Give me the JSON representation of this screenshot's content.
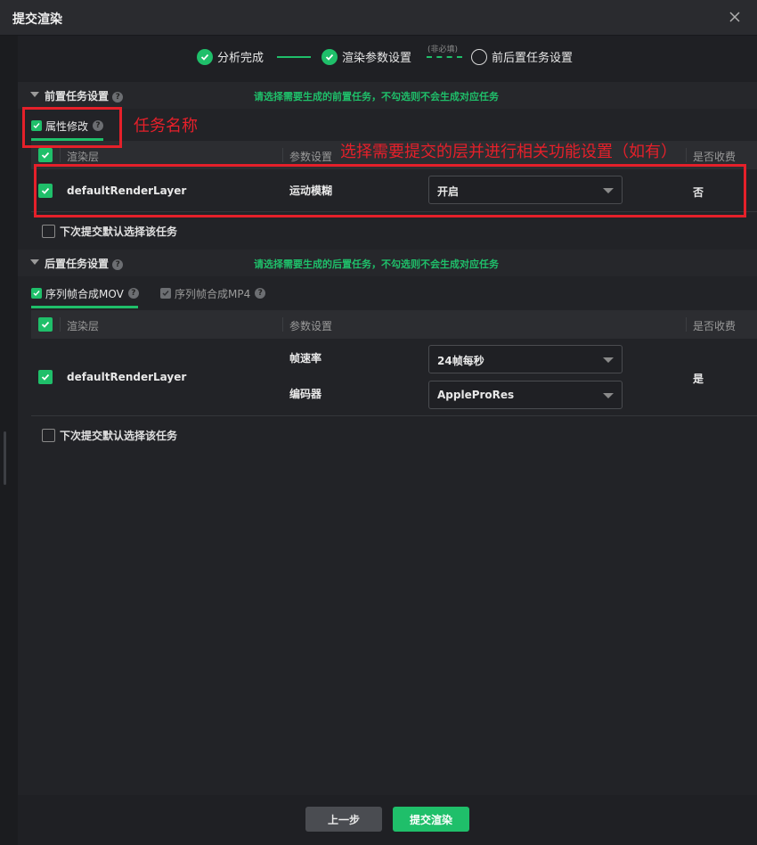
{
  "dialog": {
    "title": "提交渲染"
  },
  "steps": {
    "step1": "分析完成",
    "step2": "渲染参数设置",
    "optional": "(非必填)",
    "step3": "前后置任务设置"
  },
  "pre_task": {
    "section_label": "前置任务设置",
    "hint": "请选择需要生成的前置任务，不勾选则不会生成对应任务",
    "tab_label": "属性修改",
    "columns": {
      "layer": "渲染层",
      "params": "参数设置",
      "charge": "是否收费"
    },
    "row": {
      "layer": "defaultRenderLayer",
      "param_name": "运动模糊",
      "param_value": "开启",
      "charge": "否"
    },
    "default_label": "下次提交默认选择该任务"
  },
  "post_task": {
    "section_label": "后置任务设置",
    "hint": "请选择需要生成的后置任务，不勾选则不会生成对应任务",
    "tab1_label": "序列帧合成MOV",
    "tab2_label": "序列帧合成MP4",
    "columns": {
      "layer": "渲染层",
      "params": "参数设置",
      "charge": "是否收费"
    },
    "row": {
      "layer": "defaultRenderLayer",
      "param1_name": "帧速率",
      "param1_value": "24帧每秒",
      "param2_name": "编码器",
      "param2_value": "AppleProRes",
      "charge": "是"
    },
    "default_label": "下次提交默认选择该任务"
  },
  "annotations": {
    "task_name": "任务名称",
    "select_layer": "选择需要提交的层并进行相关功能设置（如有）"
  },
  "footer": {
    "prev": "上一步",
    "submit": "提交渲染"
  },
  "colors": {
    "accent": "#1fbf6a",
    "annotation": "#e5202a",
    "background": "#1f2024"
  }
}
